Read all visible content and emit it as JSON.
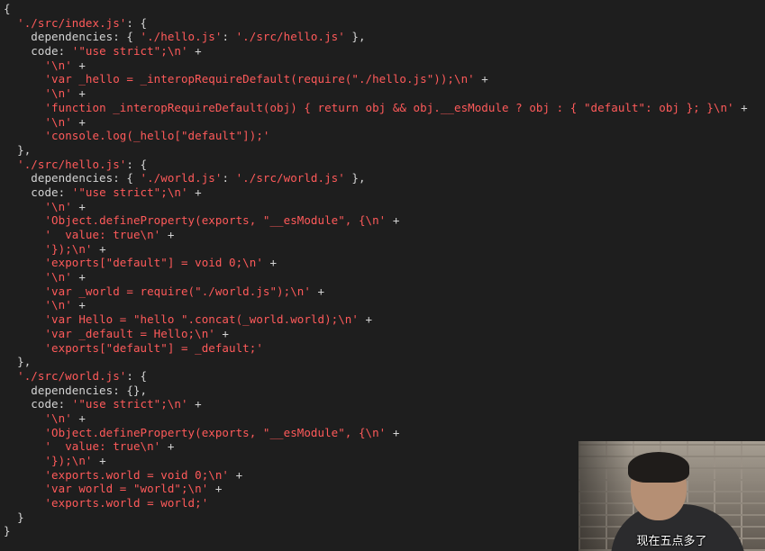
{
  "colors": {
    "background": "#1e1e1e",
    "text": "#d4d4d4",
    "string": "#ff5a5a"
  },
  "code": {
    "lines": [
      [
        [
          "p",
          "{"
        ]
      ],
      [
        [
          "p",
          "  "
        ],
        [
          "s",
          "'./src/index.js'"
        ],
        [
          "p",
          ": {"
        ]
      ],
      [
        [
          "p",
          "    dependencies: { "
        ],
        [
          "s",
          "'./hello.js'"
        ],
        [
          "p",
          ": "
        ],
        [
          "s",
          "'./src/hello.js'"
        ],
        [
          "p",
          " },"
        ]
      ],
      [
        [
          "p",
          "    code: "
        ],
        [
          "s",
          "'\"use strict\";\\n'"
        ],
        [
          "p",
          " +"
        ]
      ],
      [
        [
          "p",
          "      "
        ],
        [
          "s",
          "'\\n'"
        ],
        [
          "p",
          " +"
        ]
      ],
      [
        [
          "p",
          "      "
        ],
        [
          "s",
          "'var _hello = _interopRequireDefault(require(\"./hello.js\"));\\n'"
        ],
        [
          "p",
          " +"
        ]
      ],
      [
        [
          "p",
          "      "
        ],
        [
          "s",
          "'\\n'"
        ],
        [
          "p",
          " +"
        ]
      ],
      [
        [
          "p",
          "      "
        ],
        [
          "s",
          "'function _interopRequireDefault(obj) { return obj && obj.__esModule ? obj : { \"default\": obj }; }\\n'"
        ],
        [
          "p",
          " +"
        ]
      ],
      [
        [
          "p",
          "      "
        ],
        [
          "s",
          "'\\n'"
        ],
        [
          "p",
          " +"
        ]
      ],
      [
        [
          "p",
          "      "
        ],
        [
          "s",
          "'console.log(_hello[\"default\"]);'"
        ]
      ],
      [
        [
          "p",
          "  },"
        ]
      ],
      [
        [
          "p",
          "  "
        ],
        [
          "s",
          "'./src/hello.js'"
        ],
        [
          "p",
          ": {"
        ]
      ],
      [
        [
          "p",
          "    dependencies: { "
        ],
        [
          "s",
          "'./world.js'"
        ],
        [
          "p",
          ": "
        ],
        [
          "s",
          "'./src/world.js'"
        ],
        [
          "p",
          " },"
        ]
      ],
      [
        [
          "p",
          "    code: "
        ],
        [
          "s",
          "'\"use strict\";\\n'"
        ],
        [
          "p",
          " +"
        ]
      ],
      [
        [
          "p",
          "      "
        ],
        [
          "s",
          "'\\n'"
        ],
        [
          "p",
          " +"
        ]
      ],
      [
        [
          "p",
          "      "
        ],
        [
          "s",
          "'Object.defineProperty(exports, \"__esModule\", {\\n'"
        ],
        [
          "p",
          " +"
        ]
      ],
      [
        [
          "p",
          "      "
        ],
        [
          "s",
          "'  value: true\\n'"
        ],
        [
          "p",
          " +"
        ]
      ],
      [
        [
          "p",
          "      "
        ],
        [
          "s",
          "'});\\n'"
        ],
        [
          "p",
          " +"
        ]
      ],
      [
        [
          "p",
          "      "
        ],
        [
          "s",
          "'exports[\"default\"] = void 0;\\n'"
        ],
        [
          "p",
          " +"
        ]
      ],
      [
        [
          "p",
          "      "
        ],
        [
          "s",
          "'\\n'"
        ],
        [
          "p",
          " +"
        ]
      ],
      [
        [
          "p",
          "      "
        ],
        [
          "s",
          "'var _world = require(\"./world.js\");\\n'"
        ],
        [
          "p",
          " +"
        ]
      ],
      [
        [
          "p",
          "      "
        ],
        [
          "s",
          "'\\n'"
        ],
        [
          "p",
          " +"
        ]
      ],
      [
        [
          "p",
          "      "
        ],
        [
          "s",
          "'var Hello = \"hello \".concat(_world.world);\\n'"
        ],
        [
          "p",
          " +"
        ]
      ],
      [
        [
          "p",
          "      "
        ],
        [
          "s",
          "'var _default = Hello;\\n'"
        ],
        [
          "p",
          " +"
        ]
      ],
      [
        [
          "p",
          "      "
        ],
        [
          "s",
          "'exports[\"default\"] = _default;'"
        ]
      ],
      [
        [
          "p",
          "  },"
        ]
      ],
      [
        [
          "p",
          "  "
        ],
        [
          "s",
          "'./src/world.js'"
        ],
        [
          "p",
          ": {"
        ]
      ],
      [
        [
          "p",
          "    dependencies: {},"
        ]
      ],
      [
        [
          "p",
          "    code: "
        ],
        [
          "s",
          "'\"use strict\";\\n'"
        ],
        [
          "p",
          " +"
        ]
      ],
      [
        [
          "p",
          "      "
        ],
        [
          "s",
          "'\\n'"
        ],
        [
          "p",
          " +"
        ]
      ],
      [
        [
          "p",
          "      "
        ],
        [
          "s",
          "'Object.defineProperty(exports, \"__esModule\", {\\n'"
        ],
        [
          "p",
          " +"
        ]
      ],
      [
        [
          "p",
          "      "
        ],
        [
          "s",
          "'  value: true\\n'"
        ],
        [
          "p",
          " +"
        ]
      ],
      [
        [
          "p",
          "      "
        ],
        [
          "s",
          "'});\\n'"
        ],
        [
          "p",
          " +"
        ]
      ],
      [
        [
          "p",
          "      "
        ],
        [
          "s",
          "'exports.world = void 0;\\n'"
        ],
        [
          "p",
          " +"
        ]
      ],
      [
        [
          "p",
          "      "
        ],
        [
          "s",
          "'var world = \"world\";\\n'"
        ],
        [
          "p",
          " +"
        ]
      ],
      [
        [
          "p",
          "      "
        ],
        [
          "s",
          "'exports.world = world;'"
        ]
      ],
      [
        [
          "p",
          "  }"
        ]
      ],
      [
        [
          "p",
          "}"
        ]
      ]
    ]
  },
  "video": {
    "subtitle": "现在五点多了"
  }
}
